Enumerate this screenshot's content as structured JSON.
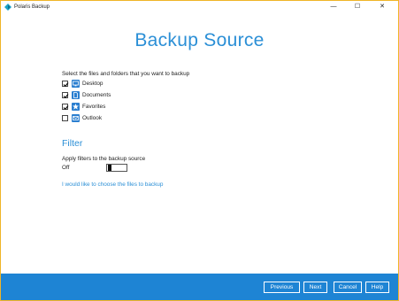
{
  "window": {
    "title": "Polaris Backup",
    "minimize_glyph": "—",
    "maximize_glyph": "☐",
    "close_glyph": "✕",
    "border_color": "#f0b528"
  },
  "page": {
    "title": "Backup Source",
    "instruction": "Select the files and folders that you want to backup",
    "accent": "#2b8fd6"
  },
  "sources": [
    {
      "label": "Desktop",
      "checked": true,
      "icon": "desktop-icon"
    },
    {
      "label": "Documents",
      "checked": true,
      "icon": "documents-icon"
    },
    {
      "label": "Favorites",
      "checked": true,
      "icon": "favorites-star-icon"
    },
    {
      "label": "Outlook",
      "checked": false,
      "icon": "outlook-icon"
    }
  ],
  "filter": {
    "section_title": "Filter",
    "label": "Apply filters to the backup source",
    "state_text": "Off",
    "enabled": false
  },
  "choose_files_link": "I would like to choose the files to backup",
  "footer": {
    "previous_label": "Previous",
    "next_label": "Next",
    "cancel_label": "Cancel",
    "help_label": "Help",
    "background": "#1e84d4"
  }
}
